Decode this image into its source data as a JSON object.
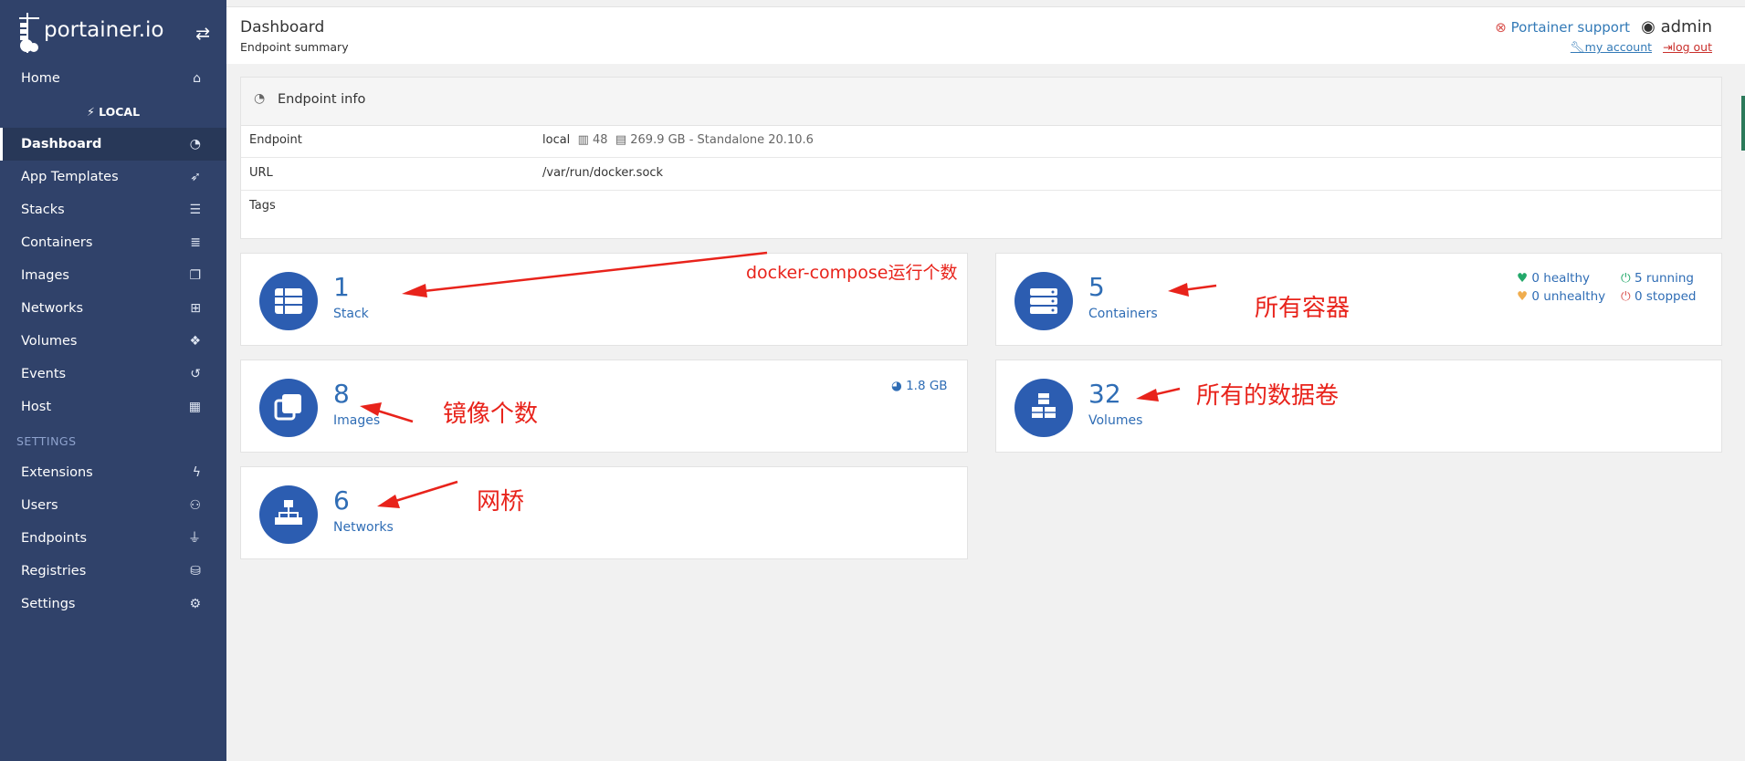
{
  "brand": {
    "name": "portainer.io",
    "toggle_icon": "swap-arrows-icon"
  },
  "sidebar": {
    "home": "Home",
    "environment": "LOCAL",
    "items": [
      {
        "label": "Dashboard",
        "icon": "dashboard-icon",
        "active": true
      },
      {
        "label": "App Templates",
        "icon": "rocket-icon"
      },
      {
        "label": "Stacks",
        "icon": "list-icon"
      },
      {
        "label": "Containers",
        "icon": "server-icon"
      },
      {
        "label": "Images",
        "icon": "clone-icon"
      },
      {
        "label": "Networks",
        "icon": "sitemap-icon"
      },
      {
        "label": "Volumes",
        "icon": "cubes-icon"
      },
      {
        "label": "Events",
        "icon": "history-icon"
      },
      {
        "label": "Host",
        "icon": "grid-icon"
      }
    ],
    "settings_title": "SETTINGS",
    "settings_items": [
      {
        "label": "Extensions",
        "icon": "bolt-icon"
      },
      {
        "label": "Users",
        "icon": "users-icon"
      },
      {
        "label": "Endpoints",
        "icon": "plug-icon"
      },
      {
        "label": "Registries",
        "icon": "database-icon"
      },
      {
        "label": "Settings",
        "icon": "cogs-icon"
      }
    ]
  },
  "header": {
    "title": "Dashboard",
    "subtitle": "Endpoint summary",
    "support": "Portainer support",
    "user": "admin",
    "my_account": "my account",
    "logout": "log out"
  },
  "endpoint_info": {
    "title": "Endpoint info",
    "rows": [
      {
        "key": "Endpoint",
        "name": "local",
        "cpu": "48",
        "memory": "269.9 GB",
        "mode": "- Standalone 20.10.6"
      },
      {
        "key": "URL",
        "value": "/var/run/docker.sock"
      },
      {
        "key": "Tags",
        "value": ""
      }
    ]
  },
  "cards": {
    "stacks": {
      "count": "1",
      "label": "Stack"
    },
    "containers": {
      "count": "5",
      "label": "Containers",
      "healthy": "0 healthy",
      "running": "5 running",
      "unhealthy": "0 unhealthy",
      "stopped": "0 stopped"
    },
    "images": {
      "count": "8",
      "label": "Images",
      "size": "1.8 GB"
    },
    "volumes": {
      "count": "32",
      "label": "Volumes"
    },
    "networks": {
      "count": "6",
      "label": "Networks"
    }
  },
  "annotations": {
    "stack": "docker-compose运行个数",
    "containers": "所有容器",
    "images": "镜像个数",
    "volumes": "所有的数据卷",
    "networks": "网桥"
  },
  "colors": {
    "sidebar": "#30426a",
    "accent": "#2f6db5",
    "circle": "#2c5db1",
    "annotation": "#e8231b"
  }
}
